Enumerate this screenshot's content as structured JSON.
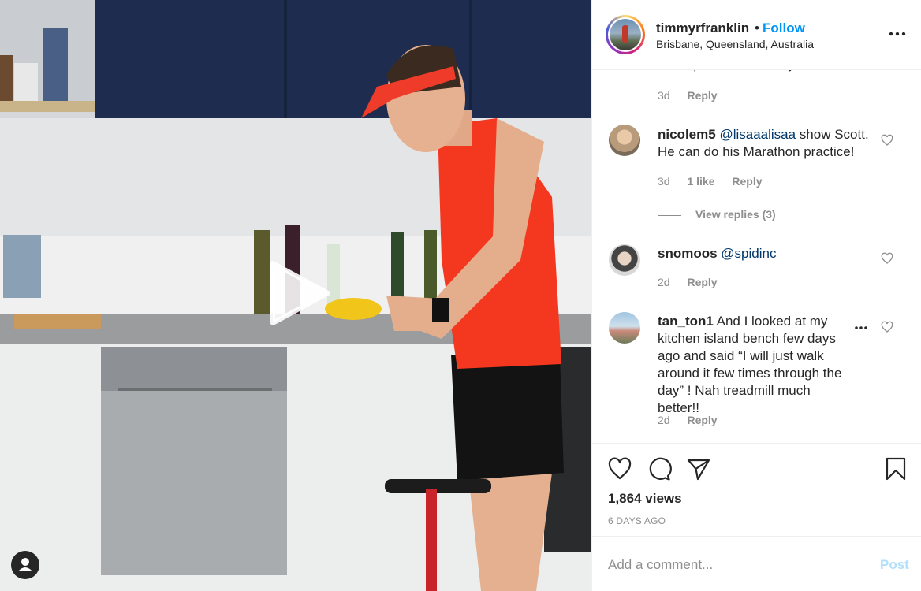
{
  "post": {
    "username": "timmyrfranklin",
    "separator": "•",
    "follow_label": "Follow",
    "location": "Brisbane, Queensland, Australia",
    "more_icon": "more-horizontal-icon"
  },
  "truncated_comment_text": "m. Hope to hear from you soon.",
  "truncated_comment_meta": {
    "time": "3d",
    "reply": "Reply"
  },
  "comments": [
    {
      "username": "nicolem5",
      "mention": "@lisaaalisaa",
      "text": " show Scott. He can do his Marathon practice!",
      "time": "3d",
      "likes": "1 like",
      "reply": "Reply",
      "view_replies": "View replies (3)"
    },
    {
      "username": "snomoos",
      "mention": "@spidinc",
      "text": "",
      "time": "2d",
      "reply": "Reply"
    },
    {
      "username": "tan_ton1",
      "text": " And I looked at my kitchen island bench few days ago and said “I will just walk around it few times through the day” ! Nah treadmill much better!!",
      "time": "2d",
      "reply": "Reply"
    }
  ],
  "actions": {
    "views": "1,864 views",
    "date": "6 DAYS AGO"
  },
  "add_comment": {
    "placeholder": "Add a comment...",
    "post_label": "Post"
  },
  "colors": {
    "link_blue": "#0095f6",
    "mention_blue": "#00376b",
    "muted": "#8e8e8e",
    "post_disabled": "#b2dffc"
  }
}
